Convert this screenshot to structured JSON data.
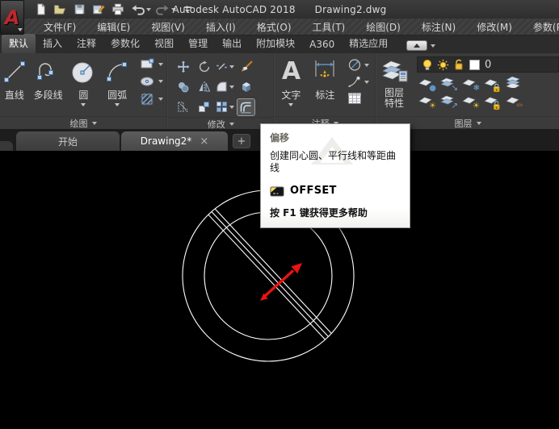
{
  "titlebar": {
    "title_app": "Autodesk AutoCAD 2018",
    "title_doc": "Drawing2.dwg"
  },
  "menubar": {
    "items": [
      {
        "label": "文件(F)"
      },
      {
        "label": "编辑(E)"
      },
      {
        "label": "视图(V)"
      },
      {
        "label": "插入(I)"
      },
      {
        "label": "格式(O)"
      },
      {
        "label": "工具(T)"
      },
      {
        "label": "绘图(D)"
      },
      {
        "label": "标注(N)"
      },
      {
        "label": "修改(M)"
      },
      {
        "label": "参数(P)"
      }
    ]
  },
  "ribbon_tabs": {
    "active_index": 0,
    "items": [
      {
        "label": "默认"
      },
      {
        "label": "插入"
      },
      {
        "label": "注释"
      },
      {
        "label": "参数化"
      },
      {
        "label": "视图"
      },
      {
        "label": "管理"
      },
      {
        "label": "输出"
      },
      {
        "label": "附加模块"
      },
      {
        "label": "A360"
      },
      {
        "label": "精选应用"
      }
    ]
  },
  "ribbon": {
    "draw": {
      "label": "绘图",
      "line": "直线",
      "polyline": "多段线",
      "circle": "圆",
      "arc": "圆弧"
    },
    "modify": {
      "label": "修改"
    },
    "annotate": {
      "label": "注释",
      "text": "文字",
      "dimension": "标注"
    },
    "layers": {
      "label": "图层",
      "properties_line1": "图层",
      "properties_line2": "特性",
      "current_layer": "0"
    }
  },
  "doc_tabs": {
    "start": "开始",
    "active": "Drawing2*",
    "close": "×",
    "new_tab": "+"
  },
  "tooltip": {
    "title": "偏移",
    "description": "创建同心圆、平行线和等距曲线",
    "command": "OFFSET",
    "help_hint": "按 F1 键获得更多帮助"
  },
  "colors": {
    "arrow_red": "#e81410",
    "entity_white": "#ffffff",
    "layer_yellow": "#ffd84a"
  }
}
